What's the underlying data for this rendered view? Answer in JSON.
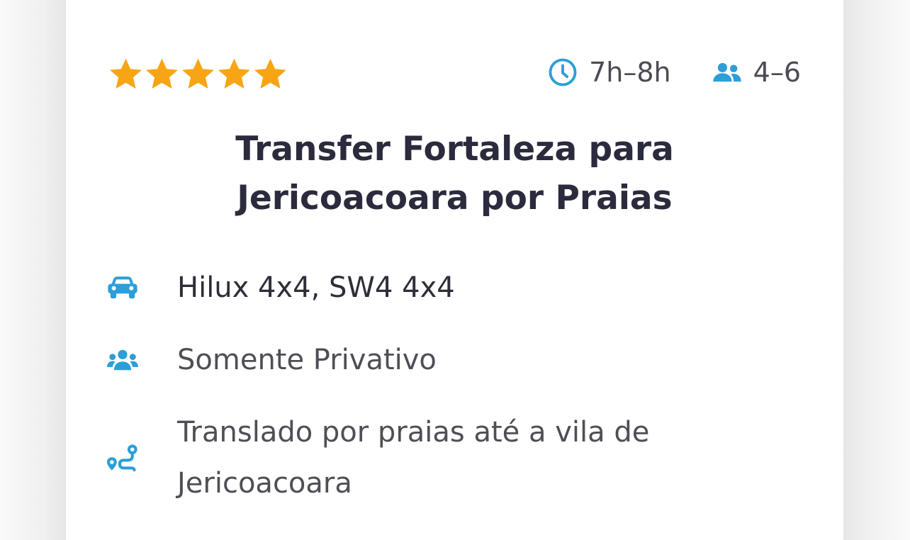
{
  "accent": "#2a9fd8",
  "star_color": "#f7a514",
  "rating": {
    "value": 5,
    "max": 5,
    "icon": "star-icon"
  },
  "meta": {
    "duration": {
      "icon": "clock-icon",
      "value": "7h–8h"
    },
    "passengers": {
      "icon": "users-icon",
      "value": "4–6"
    }
  },
  "title": {
    "line1": "Transfer Fortaleza para",
    "line2": "Jericoacoara por Praias"
  },
  "features": [
    {
      "icon": "car-icon",
      "text": "Hilux 4x4, SW4 4x4"
    },
    {
      "icon": "group-icon",
      "text": "Somente Privativo"
    },
    {
      "icon": "route-icon",
      "text": "Translado por praias até a vila de Jericoacoara"
    }
  ]
}
